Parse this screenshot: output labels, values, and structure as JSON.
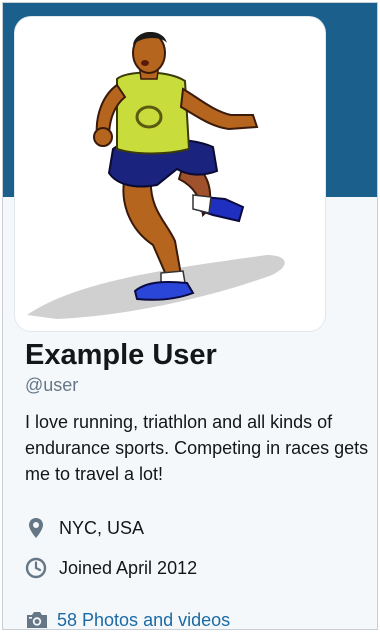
{
  "profile": {
    "display_name": "Example User",
    "handle": "@user",
    "bio": "I love running, triathlon and all kinds of endurance sports. Competing in races gets me to travel a lot!",
    "location": "NYC, USA",
    "joined": "Joined April 2012",
    "photos_link": "58 Photos and videos"
  },
  "colors": {
    "banner": "#1b5f8c",
    "page_background": "#f5f8fa",
    "link": "#1b6aa5",
    "secondary_text": "#657786",
    "icon": "#657786"
  },
  "icons": {
    "location": "map-pin-icon",
    "joined": "clock-icon",
    "photos": "camera-icon"
  }
}
